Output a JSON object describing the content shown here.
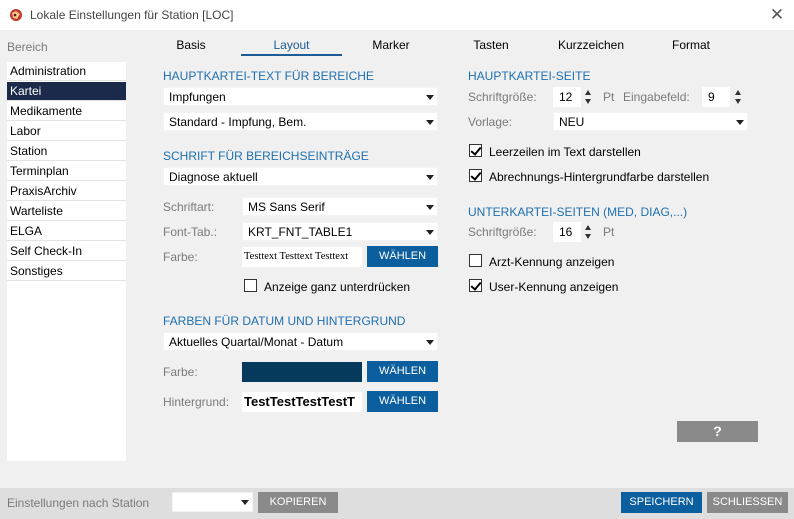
{
  "window": {
    "title": "Lokale Einstellungen für Station [LOC]",
    "close_glyph": "✕"
  },
  "sidebar": {
    "header": "Bereich",
    "items": [
      {
        "label": "Administration",
        "selected": false
      },
      {
        "label": "Kartei",
        "selected": true
      },
      {
        "label": "Medikamente",
        "selected": false
      },
      {
        "label": "Labor",
        "selected": false
      },
      {
        "label": "Station",
        "selected": false
      },
      {
        "label": "Terminplan",
        "selected": false
      },
      {
        "label": "PraxisArchiv",
        "selected": false
      },
      {
        "label": "Warteliste",
        "selected": false
      },
      {
        "label": "ELGA",
        "selected": false
      },
      {
        "label": "Self Check-In",
        "selected": false
      },
      {
        "label": "Sonstiges",
        "selected": false
      }
    ]
  },
  "tabs": [
    {
      "label": "Basis",
      "selected": false
    },
    {
      "label": "Layout",
      "selected": true
    },
    {
      "label": "Marker",
      "selected": false
    },
    {
      "label": "Tasten",
      "selected": false
    },
    {
      "label": "Kurzzeichen",
      "selected": false
    },
    {
      "label": "Format",
      "selected": false
    }
  ],
  "left": {
    "hauptkartei_text": {
      "title": "HAUPTKARTEI-TEXT FÜR BEREICHE",
      "dropdown1": "Impfungen",
      "dropdown2": "Standard - Impfung, Bem."
    },
    "schrift": {
      "title": "SCHRIFT FÜR BEREICHSEINTRÄGE",
      "dropdown": "Diagnose aktuell",
      "schriftart_label": "Schriftart:",
      "schriftart_value": "MS Sans Serif",
      "fonttab_label": "Font-Tab.:",
      "fonttab_value": "KRT_FNT_TABLE1",
      "farbe_label": "Farbe:",
      "farbe_preview": "Testtext Testtext Testtext",
      "waehlen": "WÄHLEN",
      "unterdruecken_label": "Anzeige ganz unterdrücken",
      "unterdruecken_checked": false
    },
    "farben": {
      "title": "FARBEN FÜR DATUM UND HINTERGRUND",
      "dropdown": "Aktuelles Quartal/Monat - Datum",
      "farbe_label": "Farbe:",
      "farbe_color": "#063a5c",
      "waehlen1": "WÄHLEN",
      "hintergrund_label": "Hintergrund:",
      "hintergrund_preview": "TestTestTestTestT",
      "waehlen2": "WÄHLEN"
    }
  },
  "right": {
    "hauptkartei_seite": {
      "title": "HAUPTKARTEI-SEITE",
      "schriftgroesse_label": "Schriftgröße:",
      "schriftgroesse_value": "12",
      "unit": "Pt",
      "eingabefeld_label": "Eingabefeld:",
      "eingabefeld_value": "9",
      "vorlage_label": "Vorlage:",
      "vorlage_value": "NEU",
      "leerzeilen_label": "Leerzeilen im Text darstellen",
      "leerzeilen_checked": true,
      "abrechnung_label": "Abrechnungs-Hintergrundfarbe darstellen",
      "abrechnung_checked": true
    },
    "unterkartei": {
      "title": "UNTERKARTEI-SEITEN (MED, DIAG,...)",
      "schriftgroesse_label": "Schriftgröße:",
      "schriftgroesse_value": "16",
      "unit": "Pt",
      "arzt_label": "Arzt-Kennung anzeigen",
      "arzt_checked": false,
      "user_label": "User-Kennung anzeigen",
      "user_checked": true
    },
    "help_button": "?"
  },
  "bottom": {
    "station_label": "Einstellungen nach Station",
    "station_value": "",
    "kopieren": "KOPIEREN",
    "speichern": "SPEICHERN",
    "schliessen": "SCHLIESSEN"
  },
  "colors": {
    "accent": "#0c5f9e",
    "section_title": "#1f6fb1",
    "selected_item": "#1b2a4a"
  }
}
